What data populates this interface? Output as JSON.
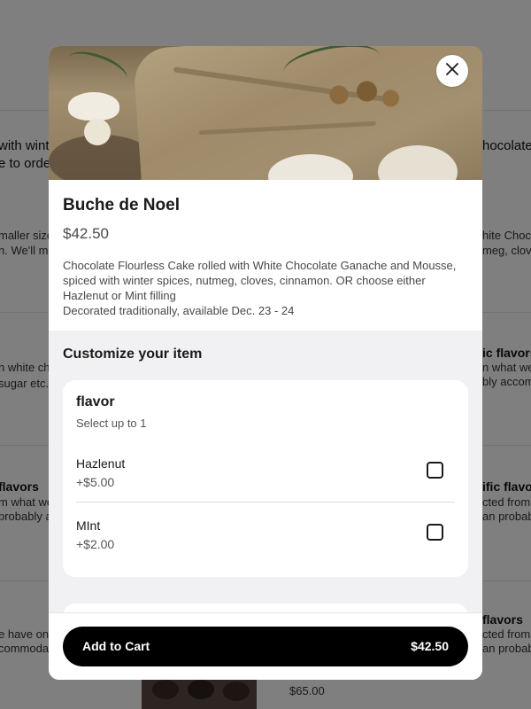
{
  "background": {
    "snippets": [
      "with winte",
      "e to orde",
      "maller size",
      "n. We'll ma",
      "h white ch",
      "sugar etc.",
      "flavors",
      "m what we",
      "probably acco",
      "e have on",
      "commodate",
      "hocolate",
      "hite Choc",
      "meg, clove",
      "ic flavors",
      "n what we",
      "bly accom",
      "ific flavo",
      "cted from",
      "an probab",
      "flavors",
      "cted from w",
      "an probab"
    ],
    "bottom_price": "$65.00"
  },
  "modal": {
    "title": "Buche de Noel",
    "price": "$42.50",
    "description": "Chocolate Flourless Cake rolled with White Chocolate Ganache and Mousse, spiced with winter spices, nutmeg, cloves, cinnamon.  OR choose either Hazlenut or Mint filling",
    "description_line2": "Decorated traditionally, available Dec. 23 - 24",
    "customize_title": "Customize your item",
    "group": {
      "name": "flavor",
      "rule": "Select up to 1",
      "options": [
        {
          "name": "Hazlenut",
          "price": "+$5.00"
        },
        {
          "name": "MInt",
          "price": "+$2.00"
        }
      ]
    },
    "footer": {
      "button_label": "Add to Cart",
      "button_price": "$42.50"
    }
  },
  "icons": {
    "close": "close-icon"
  },
  "colors": {
    "button": "#000000",
    "section_bg": "#f1f1f3",
    "scrim": "rgba(0,0,0,0.5)"
  }
}
